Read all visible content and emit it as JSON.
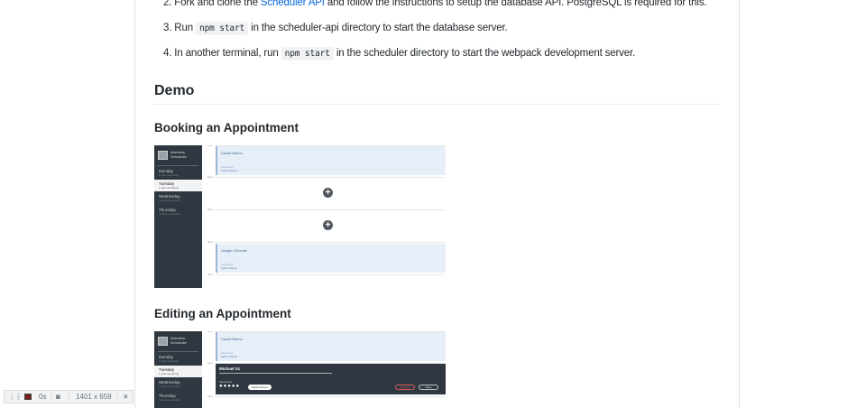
{
  "setup_steps": [
    {
      "number": "2.",
      "text_before": "Fork and clone the ",
      "link": "Scheduler API",
      "text_after": " and follow the instructions to setup the database API. PostgreSQL is required for this."
    },
    {
      "number": "3.",
      "text_before": "Run ",
      "code": "npm start",
      "text_after": " in the scheduler-api directory to start the database server."
    },
    {
      "number": "4.",
      "text_before": "In another terminal, run ",
      "code": "npm start",
      "text_after": " in the scheduler directory to start the webpack development server."
    }
  ],
  "demo": {
    "heading": "Demo",
    "booking_heading": "Booking an Appointment",
    "editing_heading": "Editing an Appointment"
  },
  "gif": {
    "logo_text": "Interview Scheduler",
    "days": [
      {
        "name": "Monday",
        "spots": "1 spot remaining"
      },
      {
        "name": "Tuesday",
        "spots": "1 spot remaining"
      },
      {
        "name": "Wednesday",
        "spots": "3 spots remaining"
      },
      {
        "name": "Thursday",
        "spots": "4 spots remaining"
      }
    ],
    "time_label": "1pm",
    "booking_appointments": [
      {
        "student": "Daniel Bolton",
        "interviewer_label": "Interviewer",
        "interviewer": "Sylvia Palmer"
      },
      {
        "student": "Vaughn Schmitz",
        "interviewer_label": "Interviewer",
        "interviewer": "Sylvia Palmer"
      }
    ],
    "add_symbol": "+",
    "editing_appointment": {
      "student": "Daniel Bolton",
      "interviewer_label": "Interviewer",
      "interviewer": "Sylvia Palmer"
    },
    "form": {
      "student_name": "Michael Sc",
      "interviewer_label": "Interviewer",
      "selected_interviewer": "Sylvia Palmer",
      "cancel_label": "Cancel",
      "save_label": "Save"
    }
  },
  "devtools_bar": {
    "timer": "0s",
    "dimensions": "1401 x 659",
    "close_glyph": "×"
  },
  "colors": {
    "link": "#0366d6",
    "sidebar": "#2f3840",
    "appointment_bg": "#e6eef8",
    "record": "#7a1e1e"
  }
}
